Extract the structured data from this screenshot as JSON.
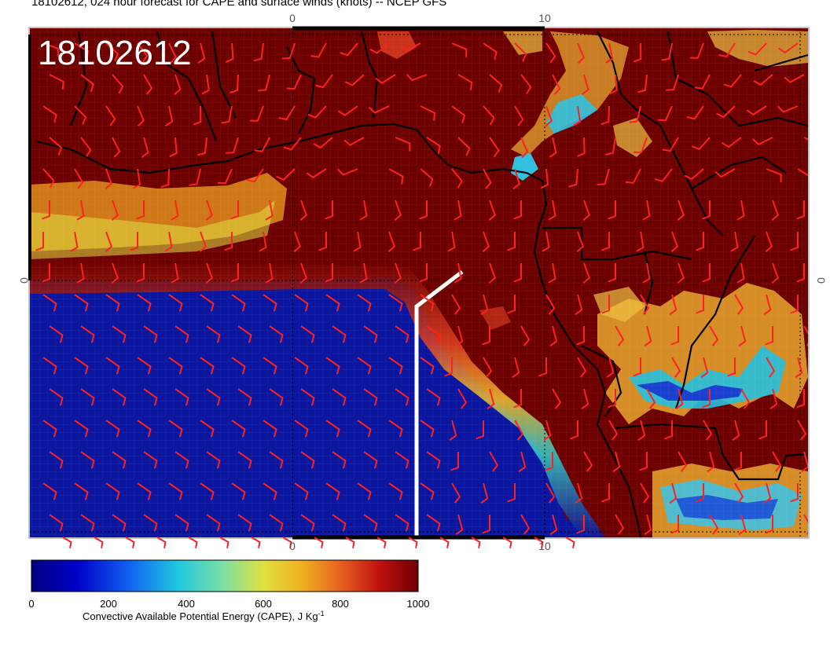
{
  "title": "18102612, 024 hour forecast for CAPE and surface winds (knots) -- NCEP GFS",
  "stamp": "18102612",
  "axes": {
    "top_ticks": [
      "0",
      "10"
    ],
    "bottom_ticks": [
      "0",
      "10"
    ],
    "left_tick": "0",
    "right_tick": "0"
  },
  "colorbar": {
    "label": "Convective Available Potential Energy (CAPE), J Kg",
    "label_superscript": "-1",
    "ticks": [
      "0",
      "200",
      "400",
      "600",
      "800",
      "1000"
    ],
    "min": 0,
    "max": 1000,
    "colors": [
      "#00007f",
      "#0000d8",
      "#1e6ff0",
      "#25d0d8",
      "#a8e080",
      "#e8e030",
      "#f0a020",
      "#e83020",
      "#b80000",
      "#6e0000"
    ]
  },
  "colors": {
    "high_cape": "#6e0000",
    "low_cape": "#0a16a0",
    "wind_barb": "#ff2020",
    "coastline": "#000000",
    "track_line": "#ffffff"
  }
}
